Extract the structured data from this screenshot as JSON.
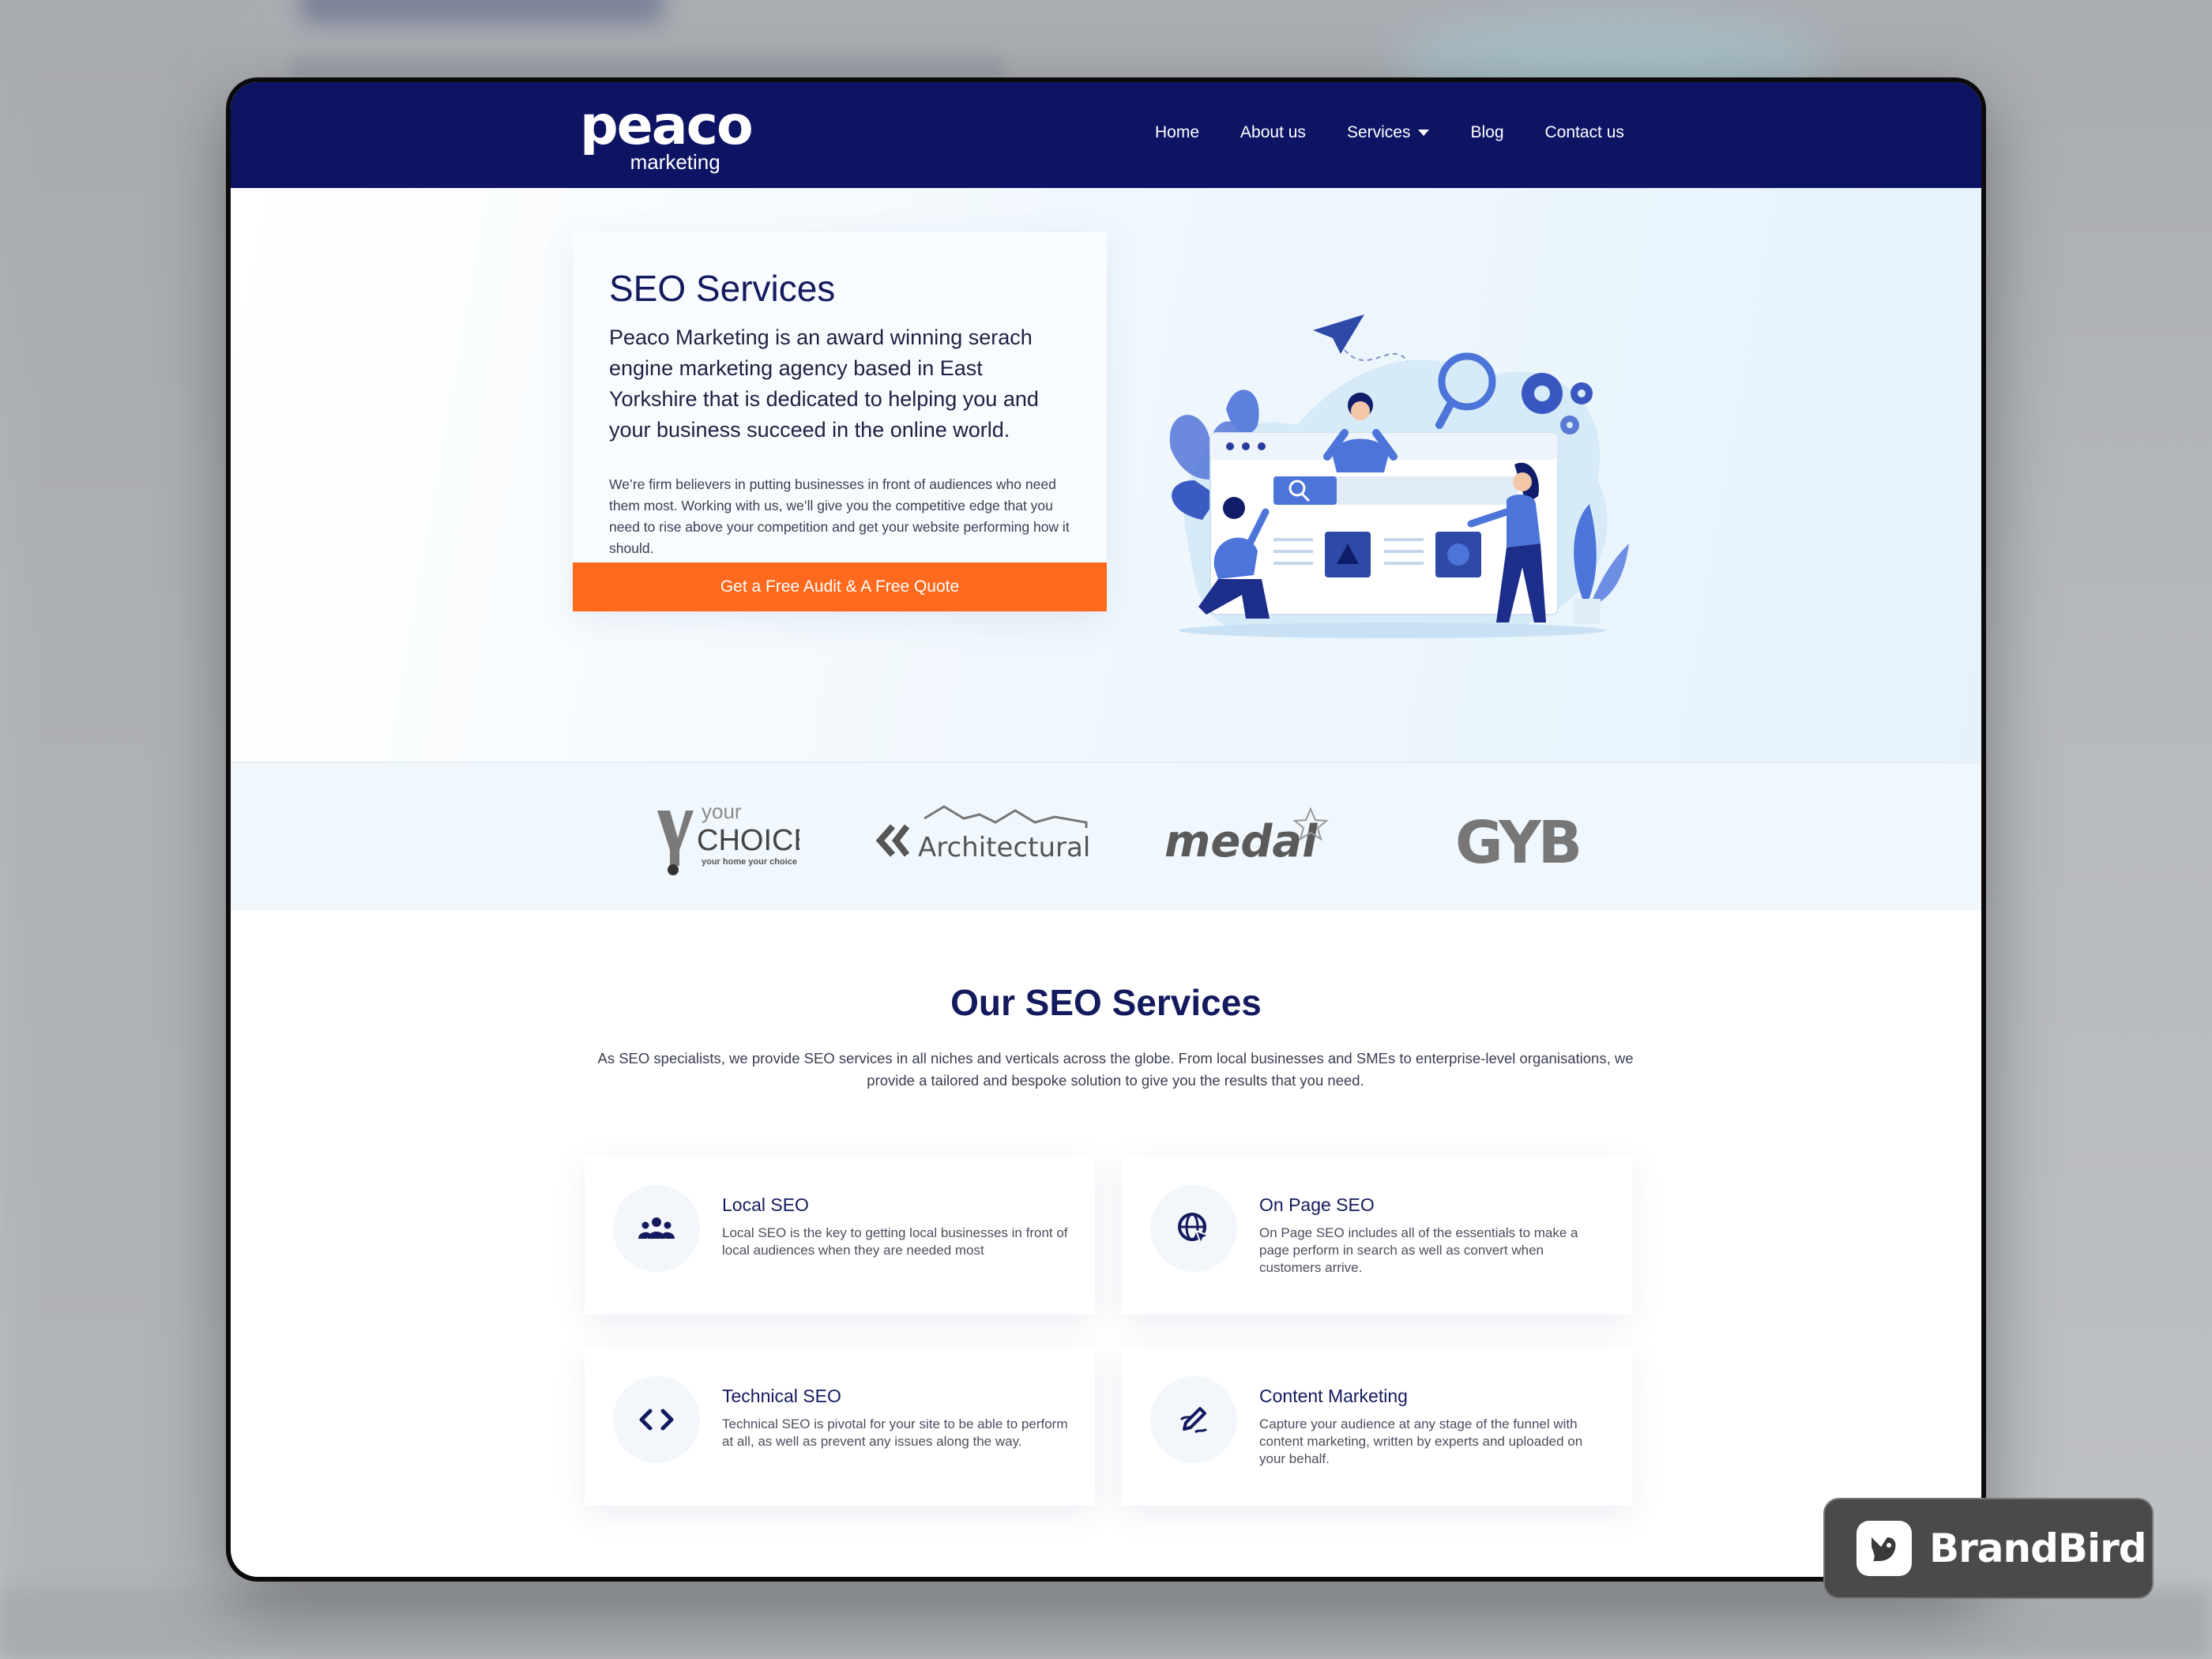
{
  "nav": {
    "logo_main": "peaco",
    "logo_sub": "marketing",
    "links": [
      "Home",
      "About us",
      "Services",
      "Blog",
      "Contact us"
    ]
  },
  "hero": {
    "title": "SEO Services",
    "lead": "Peaco Marketing is an award winning serach engine marketing agency based in East Yorkshire that is dedicated to helping you and your business succeed in the online world.",
    "body": "We’re firm believers in putting businesses in front of audiences who need them most. Working with us, we’ll give you the competitive edge that you need to rise above your competition and get your website performing how it should.",
    "cta": "Get a Free Audit & A Free Quote"
  },
  "clients": {
    "your_choice": {
      "top": "your",
      "main": "CHOICE",
      "tagline": "your home your choice"
    },
    "architectural": "Architectural",
    "medal": "medal",
    "gyb": "GYB"
  },
  "services": {
    "title": "Our SEO Services",
    "intro": "As SEO specialists, we provide SEO services in all niches and verticals across the globe. From local businesses and SMEs to enterprise-level organisations, we provide a tailored and bespoke solution to give you the results that you need.",
    "items": [
      {
        "title": "Local SEO",
        "desc": "Local SEO is the key to getting local businesses in front of local audiences when they are needed most",
        "icon": "users-icon"
      },
      {
        "title": "On Page SEO",
        "desc": "On Page SEO includes all of the essentials to make a page perform in search as well as convert when customers arrive.",
        "icon": "globe-cursor-icon"
      },
      {
        "title": "Technical SEO",
        "desc": "Technical SEO is pivotal for your site to be able to perform at all, as well as prevent any issues along the way.",
        "icon": "code-icon"
      },
      {
        "title": "Content Marketing",
        "desc": "Capture your audience at any stage of the funnel with content marketing, written by experts and uploaded on your behalf.",
        "icon": "pen-icon"
      }
    ]
  },
  "badge": {
    "label": "BrandBird"
  },
  "colors": {
    "nav": "#0d1464",
    "accent": "#ff6a1f",
    "heading": "#141a5e"
  }
}
